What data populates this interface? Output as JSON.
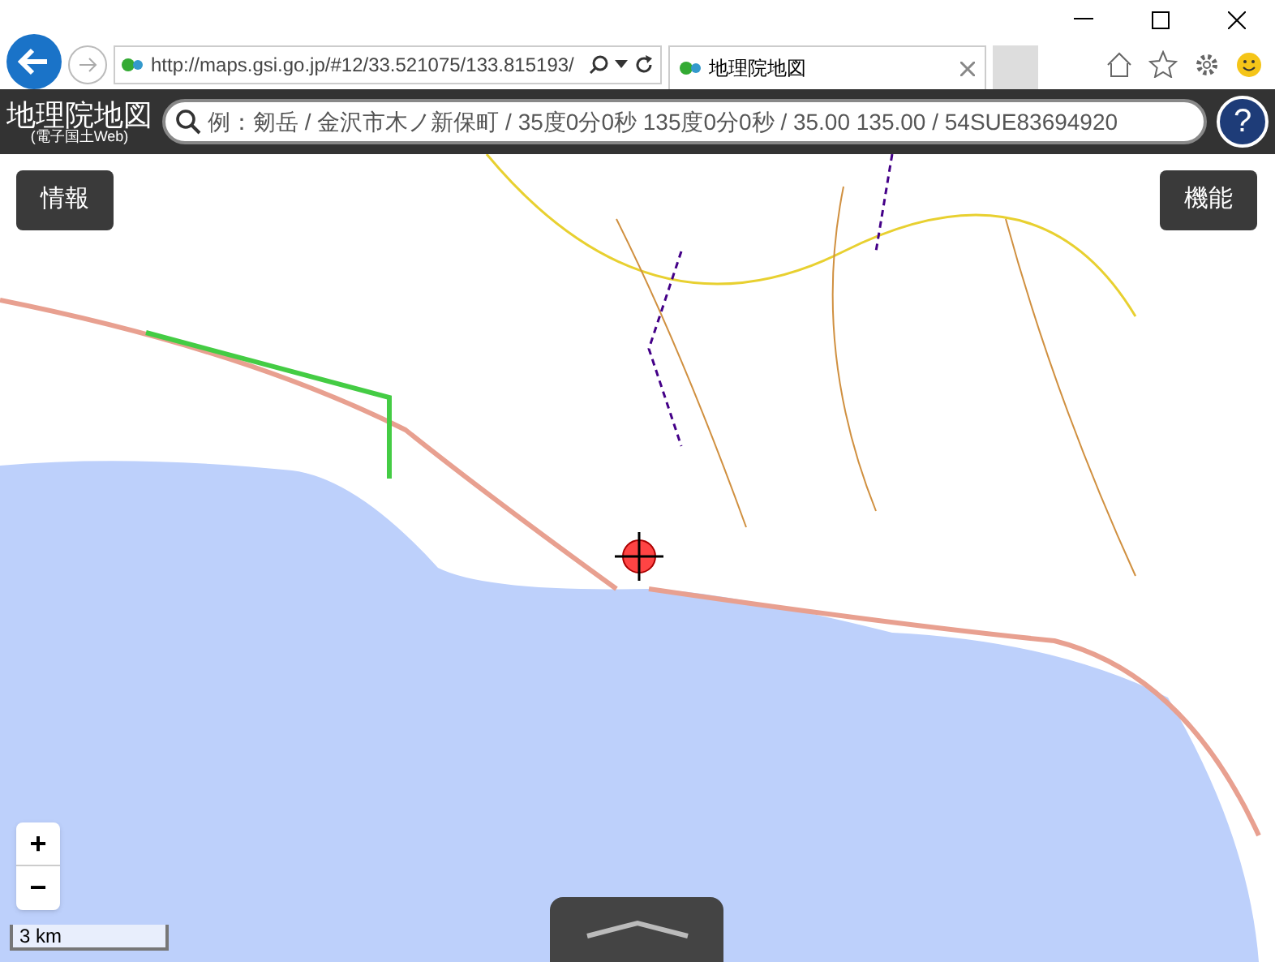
{
  "browser": {
    "address": "http://maps.gsi.go.jp/#12/33.521075/133.815193/",
    "tab": {
      "title": "地理院地図",
      "selected": true
    }
  },
  "header": {
    "title": "地理院地図",
    "subtitle": "(電子国土Web)",
    "search": {
      "placeholder": "例：剱岳 / 金沢市木ノ新保町 / 35度0分0秒 135度0分0秒 / 35.00 135.00 / 54SUE83694920"
    },
    "help": "?"
  },
  "map": {
    "info_button": "情報",
    "tools_button": "機能",
    "zoom_in": "+",
    "zoom_out": "−",
    "scale": "3 km"
  }
}
